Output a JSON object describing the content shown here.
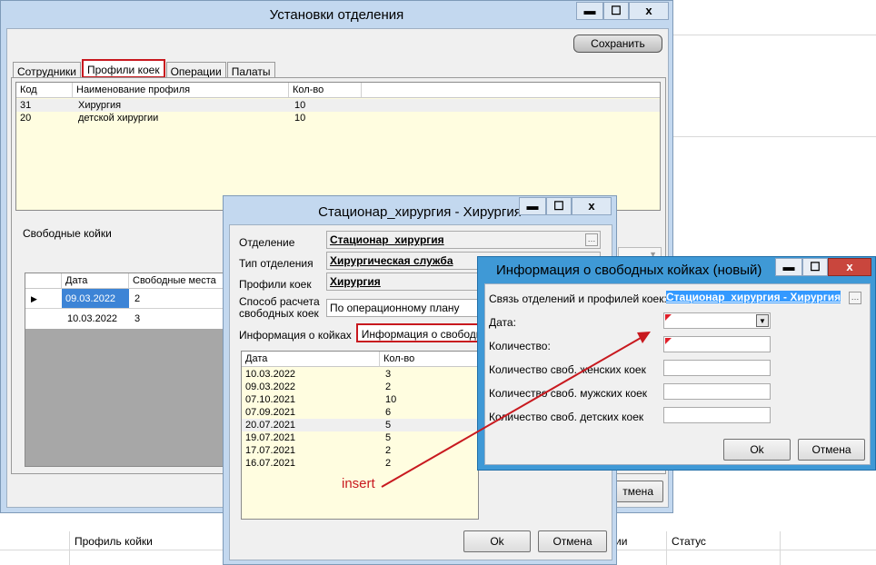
{
  "background": {
    "col_profile": "Профиль койки",
    "col_partial": "ии",
    "col_status": "Статус"
  },
  "main_window": {
    "title": "Установки отделения",
    "save_button": "Сохранить",
    "tabs": [
      "Сотрудники",
      "Профили коек",
      "Операции",
      "Палаты"
    ],
    "active_tab": 1,
    "profiles_grid": {
      "headers": [
        "Код",
        "Наименование профиля",
        "Кол-во"
      ],
      "rows": [
        [
          "31",
          "Хирургия",
          "10"
        ],
        [
          "20",
          "детской хирургии",
          "10"
        ]
      ]
    },
    "free_beds_label": "Свободные койки",
    "free_beds_grid": {
      "headers": [
        "Дата",
        "Свободные места"
      ],
      "rows": [
        [
          "09.03.2022",
          "2"
        ],
        [
          "10.03.2022",
          "3"
        ]
      ]
    },
    "cancel_button_partial": "тмена"
  },
  "profile_window": {
    "title": "Стационар_хирургия - Хирургия",
    "labels": {
      "department": "Отделение",
      "department_type": "Тип отделения",
      "bed_profile": "Профили коек",
      "calc_method": "Способ расчета свободных коек"
    },
    "values": {
      "department": "Стационар_хирургия",
      "department_type": "Хирургическая служба",
      "bed_profile": "Хирургия",
      "calc_method": "По операционному плану"
    },
    "tabs": [
      "Информация о койках",
      "Информация о свободных"
    ],
    "active_tab": 1,
    "grid": {
      "headers": [
        "Дата",
        "Кол-во"
      ],
      "rows": [
        [
          "10.03.2022",
          "3"
        ],
        [
          "09.03.2022",
          "2"
        ],
        [
          "07.10.2021",
          "10"
        ],
        [
          "07.09.2021",
          "6"
        ],
        [
          "20.07.2021",
          "5"
        ],
        [
          "19.07.2021",
          "5"
        ],
        [
          "17.07.2021",
          "2"
        ],
        [
          "16.07.2021",
          "2"
        ]
      ]
    },
    "ok_button": "Ok",
    "cancel_button": "Отмена"
  },
  "info_window": {
    "title": "Информация о свободных койках (новый)",
    "labels": {
      "link": "Связь отделений и профилей коек:",
      "date": "Дата:",
      "count": "Количество:",
      "female": "Количество своб. женских коек",
      "male": "Количество своб. мужских коек",
      "child": "Количество своб. детских коек"
    },
    "values": {
      "link": "Стационар_хирургия - Хирургия",
      "date": "",
      "count": "",
      "female": "",
      "male": "",
      "child": ""
    },
    "ok_button": "Ok",
    "cancel_button": "Отмена"
  },
  "annotation": {
    "text": "insert",
    "color": "#c8191f"
  },
  "window_buttons": {
    "minimize": "▬",
    "maximize": "☐",
    "close": "x"
  }
}
